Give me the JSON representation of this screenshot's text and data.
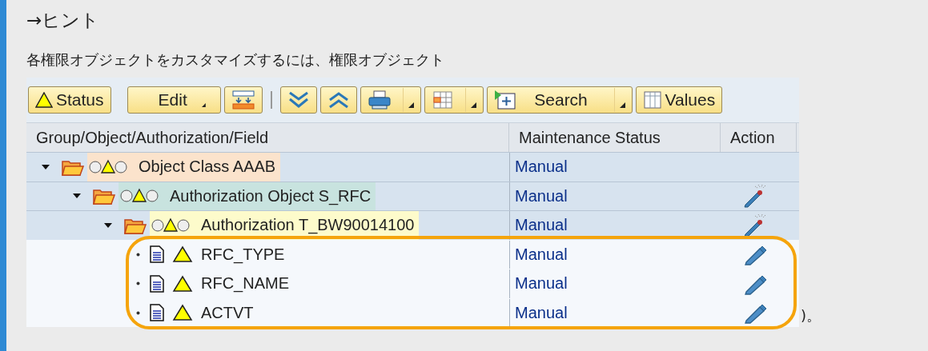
{
  "hint": {
    "title": "→ヒント",
    "text": "各権限オブジェクトをカスタマイズするには、権限オブジェクト",
    "trailing": ")。"
  },
  "toolbar": [
    {
      "kind": "button",
      "label": "Status"
    },
    {
      "kind": "menu",
      "label": "Edit"
    },
    {
      "kind": "icon"
    },
    {
      "kind": "separator"
    },
    {
      "kind": "icon"
    },
    {
      "kind": "icon"
    },
    {
      "kind": "split"
    },
    {
      "kind": "split"
    },
    {
      "kind": "split",
      "label": "Search"
    },
    {
      "kind": "button",
      "label": "Values"
    }
  ],
  "table": {
    "columns": [
      "Group/Object/Authorization/Field",
      "Maintenance Status",
      "Action"
    ],
    "rows": [
      {
        "kind": "class",
        "label": "Object Class AAAB",
        "status": "Manual",
        "expanded": true,
        "children": [
          {
            "kind": "object",
            "label": "Authorization Object S_RFC",
            "status": "Manual",
            "expanded": true,
            "children": [
              {
                "kind": "authorization",
                "label": "Authorization T_BW90014100",
                "status": "Manual",
                "expanded": true,
                "children": [
                  {
                    "kind": "field",
                    "label": "RFC_TYPE",
                    "status": "Manual",
                    "highlighted": true
                  },
                  {
                    "kind": "field",
                    "label": "RFC_NAME",
                    "status": "Manual",
                    "highlighted": true
                  },
                  {
                    "kind": "field",
                    "label": "ACTVT",
                    "status": "Manual",
                    "highlighted": true
                  }
                ]
              }
            ]
          }
        ]
      }
    ]
  }
}
